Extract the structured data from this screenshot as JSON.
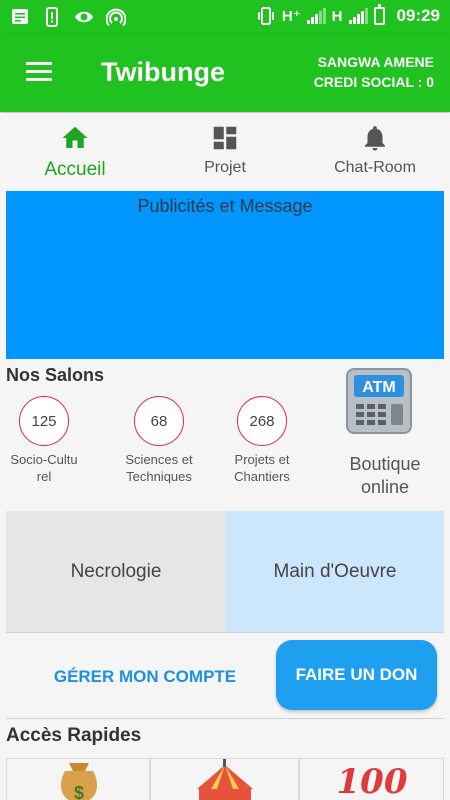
{
  "statusbar": {
    "time": "09:29",
    "network_1": "H⁺",
    "network_2": "H"
  },
  "appbar": {
    "title": "Twibunge",
    "user_name": "SANGWA AMENE",
    "credit": "CREDI SOCIAL : 0"
  },
  "tabs": [
    {
      "label": "Accueil",
      "icon": "home-icon",
      "active": true
    },
    {
      "label": "Projet",
      "icon": "dashboard-icon",
      "active": false
    },
    {
      "label": "Chat-Room",
      "icon": "bell-icon",
      "active": false
    }
  ],
  "banner": {
    "text": "Publicités et Message"
  },
  "salons": {
    "title": "Nos Salons",
    "items": [
      {
        "count": "125",
        "label": "Socio-Cultu\nrel"
      },
      {
        "count": "68",
        "label": "Sciences et\nTechniques"
      },
      {
        "count": "268",
        "label": "Projets et\nChantiers"
      }
    ],
    "boutique": "Boutique\nonline",
    "atm_label": "ATM"
  },
  "tiles": {
    "necrologie": "Necrologie",
    "main_oeuvre": "Main d'Oeuvre"
  },
  "actions": {
    "manage": "GÉRER MON COMPTE",
    "donate": "FAIRE UN DON"
  },
  "quick_access": {
    "title": "Accès Rapides",
    "hundred": "100"
  },
  "colors": {
    "primary_green": "#1fc21f",
    "banner_blue": "#0096ff",
    "donate_blue": "#1e9ff0"
  }
}
